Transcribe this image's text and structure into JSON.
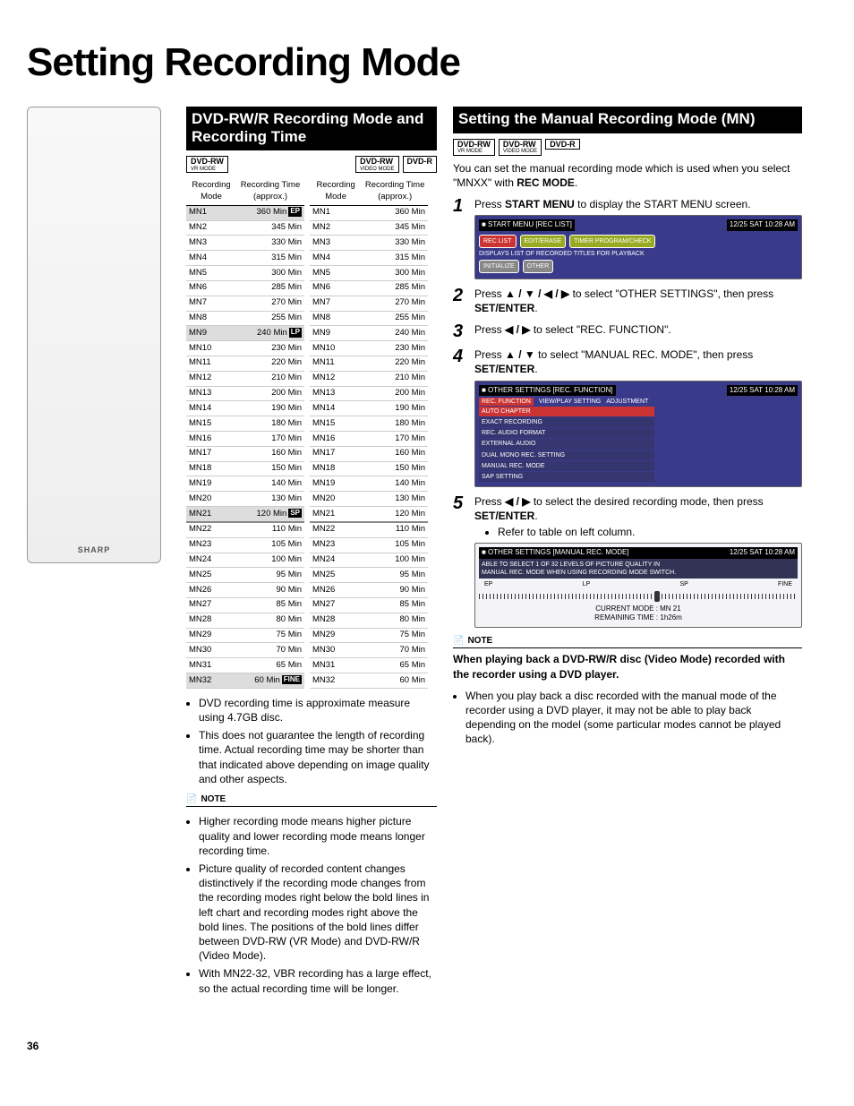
{
  "page_title": "Setting Recording Mode",
  "page_number": "36",
  "mid": {
    "heading": "DVD-RW/R Recording Mode and Recording Time",
    "badge_left": {
      "top": "DVD-RW",
      "sub": "VR MODE"
    },
    "badge_right_a": {
      "top": "DVD-RW",
      "sub": "VIDEO MODE"
    },
    "badge_right_b": {
      "top": "DVD-R",
      "sub": ""
    },
    "col_headers": {
      "mode": "Recording Mode",
      "time": "Recording Time (approx.)"
    },
    "rows_left": [
      {
        "m": "MN1",
        "t": "360 Min",
        "sh": true,
        "tag": "EP"
      },
      {
        "m": "MN2",
        "t": "345 Min"
      },
      {
        "m": "MN3",
        "t": "330 Min"
      },
      {
        "m": "MN4",
        "t": "315 Min"
      },
      {
        "m": "MN5",
        "t": "300 Min"
      },
      {
        "m": "MN6",
        "t": "285 Min"
      },
      {
        "m": "MN7",
        "t": "270 Min"
      },
      {
        "m": "MN8",
        "t": "255 Min"
      },
      {
        "m": "MN9",
        "t": "240 Min",
        "sh": true,
        "tag": "LP"
      },
      {
        "m": "MN10",
        "t": "230 Min"
      },
      {
        "m": "MN11",
        "t": "220 Min"
      },
      {
        "m": "MN12",
        "t": "210 Min"
      },
      {
        "m": "MN13",
        "t": "200 Min"
      },
      {
        "m": "MN14",
        "t": "190 Min"
      },
      {
        "m": "MN15",
        "t": "180 Min"
      },
      {
        "m": "MN16",
        "t": "170 Min"
      },
      {
        "m": "MN17",
        "t": "160 Min"
      },
      {
        "m": "MN18",
        "t": "150 Min"
      },
      {
        "m": "MN19",
        "t": "140 Min"
      },
      {
        "m": "MN20",
        "t": "130 Min"
      },
      {
        "m": "MN21",
        "t": "120 Min",
        "sh": true,
        "tag": "SP"
      },
      {
        "m": "MN22",
        "t": "110 Min",
        "bl": true
      },
      {
        "m": "MN23",
        "t": "105 Min"
      },
      {
        "m": "MN24",
        "t": "100 Min"
      },
      {
        "m": "MN25",
        "t": "95 Min"
      },
      {
        "m": "MN26",
        "t": "90 Min"
      },
      {
        "m": "MN27",
        "t": "85 Min"
      },
      {
        "m": "MN28",
        "t": "80 Min"
      },
      {
        "m": "MN29",
        "t": "75 Min"
      },
      {
        "m": "MN30",
        "t": "70 Min"
      },
      {
        "m": "MN31",
        "t": "65 Min"
      },
      {
        "m": "MN32",
        "t": "60 Min",
        "sh": true,
        "tag": "FINE"
      }
    ],
    "rows_right": [
      {
        "m": "MN1",
        "t": "360 Min"
      },
      {
        "m": "MN2",
        "t": "345 Min"
      },
      {
        "m": "MN3",
        "t": "330 Min"
      },
      {
        "m": "MN4",
        "t": "315 Min"
      },
      {
        "m": "MN5",
        "t": "300 Min"
      },
      {
        "m": "MN6",
        "t": "285 Min"
      },
      {
        "m": "MN7",
        "t": "270 Min"
      },
      {
        "m": "MN8",
        "t": "255 Min"
      },
      {
        "m": "MN9",
        "t": "240 Min"
      },
      {
        "m": "MN10",
        "t": "230 Min"
      },
      {
        "m": "MN11",
        "t": "220 Min"
      },
      {
        "m": "MN12",
        "t": "210 Min"
      },
      {
        "m": "MN13",
        "t": "200 Min"
      },
      {
        "m": "MN14",
        "t": "190 Min"
      },
      {
        "m": "MN15",
        "t": "180 Min"
      },
      {
        "m": "MN16",
        "t": "170 Min"
      },
      {
        "m": "MN17",
        "t": "160 Min"
      },
      {
        "m": "MN18",
        "t": "150 Min"
      },
      {
        "m": "MN19",
        "t": "140 Min"
      },
      {
        "m": "MN20",
        "t": "130 Min"
      },
      {
        "m": "MN21",
        "t": "120 Min"
      },
      {
        "m": "MN22",
        "t": "110 Min",
        "bl": true
      },
      {
        "m": "MN23",
        "t": "105 Min"
      },
      {
        "m": "MN24",
        "t": "100 Min"
      },
      {
        "m": "MN25",
        "t": "95 Min"
      },
      {
        "m": "MN26",
        "t": "90 Min"
      },
      {
        "m": "MN27",
        "t": "85 Min"
      },
      {
        "m": "MN28",
        "t": "80 Min"
      },
      {
        "m": "MN29",
        "t": "75 Min"
      },
      {
        "m": "MN30",
        "t": "70 Min"
      },
      {
        "m": "MN31",
        "t": "65 Min"
      },
      {
        "m": "MN32",
        "t": "60 Min"
      }
    ],
    "bullets_after_table": [
      "DVD recording time is approximate measure using 4.7GB disc.",
      "This does not guarantee the length of recording time. Actual recording time may be shorter than that indicated above depending on image quality and other aspects."
    ],
    "note_label": "NOTE",
    "note_bullets": [
      "Higher recording mode means higher picture quality and lower recording mode means longer recording time.",
      "Picture quality of recorded content changes distinctively if the recording mode changes from the recording modes right below the bold lines in left chart and recording modes right above the bold lines. The positions of the bold lines differ between DVD-RW (VR Mode) and DVD-RW/R (Video Mode).",
      "With MN22-32, VBR recording has a large effect, so the actual recording time will be longer."
    ]
  },
  "right": {
    "heading": "Setting the Manual Recording Mode (MN)",
    "badges": [
      {
        "top": "DVD-RW",
        "sub": "VR MODE"
      },
      {
        "top": "DVD-RW",
        "sub": "VIDEO MODE"
      },
      {
        "top": "DVD-R",
        "sub": ""
      }
    ],
    "intro_a": "You can set the manual recording mode which is used when you select \"MNXX\" with ",
    "intro_b": "REC MODE",
    "intro_c": ".",
    "steps": [
      {
        "n": "1",
        "pre": "Press ",
        "bold1": "START MENU",
        "mid": " to display the START MENU screen.",
        "osd": "start"
      },
      {
        "n": "2",
        "pre": "Press ",
        "arrows": "▲ / ▼ / ◀ / ▶",
        "mid": " to select \"OTHER SETTINGS\", then press ",
        "bold2": "SET/ENTER",
        "post": "."
      },
      {
        "n": "3",
        "pre": "Press ",
        "arrows": "◀ / ▶",
        "mid": " to select \"REC. FUNCTION\"."
      },
      {
        "n": "4",
        "pre": "Press ",
        "arrows": "▲ / ▼",
        "mid": " to select \"MANUAL REC. MODE\", then press ",
        "bold2": "SET/ENTER",
        "post": ".",
        "osd": "func"
      },
      {
        "n": "5",
        "pre": "Press ",
        "arrows": "◀ / ▶",
        "mid": " to select the desired recording mode, then press ",
        "bold2": "SET/ENTER",
        "post": ".",
        "sub": "Refer to table on left column.",
        "osd": "mn"
      }
    ],
    "osd_start": {
      "title": "START MENU [REC LIST]",
      "time": "12/25 SAT 10:28 AM",
      "btn1": "REC LIST",
      "btn2": "EDIT/ERASE",
      "btn3": "TIMER PROGRAM/CHECK",
      "desc": "DISPLAYS LIST OF RECORDED TITLES FOR PLAYBACK",
      "btn4": "INITIALIZE",
      "btn5": "OTHER"
    },
    "osd_func": {
      "title": "OTHER SETTINGS [REC. FUNCTION]",
      "time": "12/25 SAT 10:28 AM",
      "tabs": [
        "REC. FUNCTION",
        "VIEW/PLAY SETTING",
        "ADJUSTMENT"
      ],
      "items": [
        "AUTO CHAPTER",
        "EXACT RECORDING",
        "REC. AUDIO FORMAT",
        "EXTERNAL AUDIO",
        "DUAL MONO REC. SETTING",
        "MANUAL REC. MODE",
        "SAP SETTING"
      ]
    },
    "osd_mn": {
      "title": "OTHER SETTINGS [MANUAL REC. MODE]",
      "time": "12/25 SAT 10:28 AM",
      "line1": "ABLE TO SELECT 1 OF 32 LEVELS OF PICTURE QUALITY IN",
      "line2": "MANUAL REC. MODE WHEN USING RECORDING MODE SWITCH.",
      "scale": [
        "EP",
        "LP",
        "SP",
        "FINE"
      ],
      "cur": "CURRENT MODE : MN 21",
      "rem": "REMAINING TIME : 1h26m"
    },
    "note_label": "NOTE",
    "note_heading": "When playing back a DVD-RW/R disc (Video Mode) recorded with the recorder using a DVD player.",
    "note_bullet": "When you play back a disc recorded with the manual mode of the recorder using a DVD player, it may not be able to play back depending on the model (some particular modes cannot be played back)."
  }
}
